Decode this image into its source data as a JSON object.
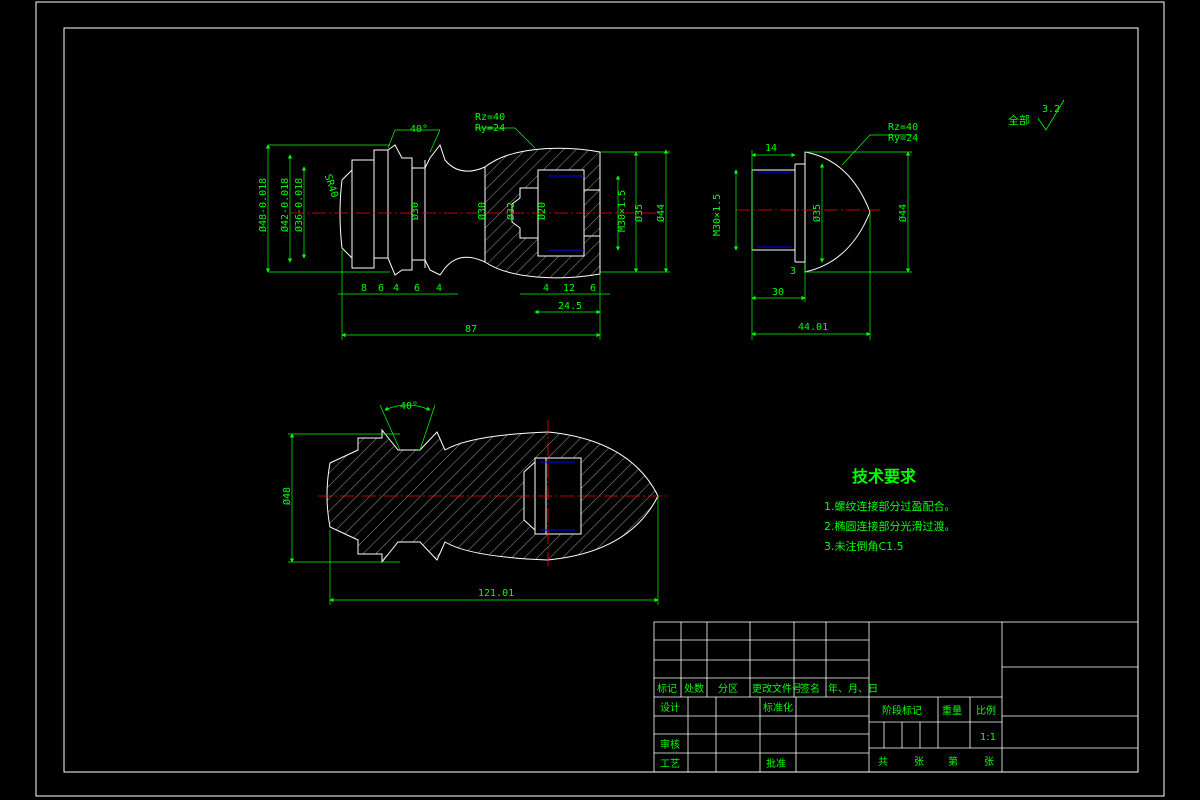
{
  "colors": {
    "background": "#000000",
    "geometry": "#ffffff",
    "dimension": "#00ff00",
    "centerline": "#ff0000",
    "thread": "#0000ff"
  },
  "roughness": {
    "global_label": "全部",
    "global_value": "3.2",
    "r1": "Rz=40",
    "r2": "Ry=24"
  },
  "view1": {
    "angle": "40°",
    "sphere": "SR40",
    "dia_left": [
      "Ø48-0.018",
      "Ø42-0.018",
      "Ø36-0.018"
    ],
    "dia_inner": [
      "Ø30",
      "Ø30",
      "Ø32",
      "Ø20"
    ],
    "thread": "M30×1.5",
    "dia_right": [
      "Ø35",
      "Ø44"
    ],
    "bottom_dims": [
      "8",
      "6",
      "4",
      "6",
      "4",
      "4",
      "12",
      "6"
    ],
    "d_24_5": "24.5",
    "total": "87"
  },
  "view2": {
    "d14": "14",
    "thread": "M30×1.5",
    "dia35": "Ø35",
    "dia44": "Ø44",
    "d3": "3",
    "d30": "30",
    "total": "44.01"
  },
  "view3": {
    "angle": "40°",
    "dia": "Ø48",
    "total": "121.01"
  },
  "notes": {
    "title": "技术要求",
    "items": [
      "1.螺纹连接部分过盈配合。",
      "2.椭圆连接部分光滑过渡。",
      "3.未注倒角C1.5"
    ]
  },
  "title_block": {
    "header": [
      "标记",
      "处数",
      "分区",
      "更改文件号",
      "签名",
      "年、月、日"
    ],
    "design": "设计",
    "standard": "标准化",
    "review": "审核",
    "process": "工艺",
    "approve": "批准",
    "stage": "阶段标记",
    "weight": "重量",
    "scale_label": "比例",
    "scale_value": "1:1",
    "total_label": "共",
    "sheets": "张",
    "page_label": "第",
    "page_sheets": "张"
  }
}
